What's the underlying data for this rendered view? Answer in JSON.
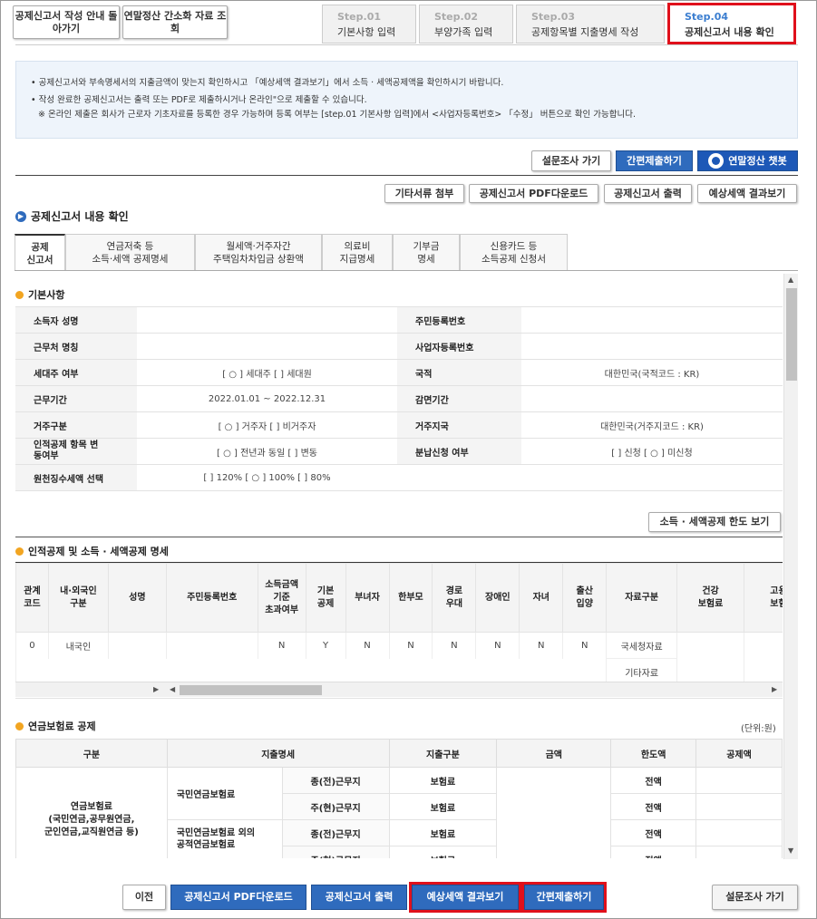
{
  "top_buttons": {
    "guide": "공제신고서 작성 안내 돌아가기",
    "lookup": "연말정산 간소화 자료 조회"
  },
  "steps": [
    {
      "num": "Step.01",
      "title": "기본사항 입력"
    },
    {
      "num": "Step.02",
      "title": "부양가족 입력"
    },
    {
      "num": "Step.03",
      "title": "공제항목별 지출명세 작성"
    },
    {
      "num": "Step.04",
      "title": "공제신고서 내용 확인"
    }
  ],
  "info": {
    "line1": "공제신고서와 부속명세서의 지출금액이 맞는지 확인하시고 「예상세액 결과보기」에서 소득 · 세액공제액을 확인하시기 바랍니다.",
    "line2": "작성 완료한 공제신고서는 출력 또는 PDF로 제출하시거나 온라인\"으로 제출할 수 있습니다.",
    "line3": "※ 온라인 제출은 회사가 근로자 기초자료를 등록한 경우 가능하며 등록 여부는 [step.01 기본사항 입력]에서 <사업자등록번호> 「수정」 버튼으로 확인 가능합니다."
  },
  "action_row1": {
    "survey": "설문조사 가기",
    "submit": "간편제출하기",
    "chatbot": "연말정산 챗봇"
  },
  "action_row2": {
    "attach": "기타서류 첨부",
    "pdf": "공제신고서 PDF다운로드",
    "print": "공제신고서 출력",
    "estimate": "예상세액 결과보기"
  },
  "page_title": "공제신고서 내용 확인",
  "tabs": [
    {
      "l1": "공제",
      "l2": "신고서"
    },
    {
      "l1": "연금저축 등",
      "l2": "소득·세액 공제명세"
    },
    {
      "l1": "월세액·거주자간",
      "l2": "주택임차차입금 상환액"
    },
    {
      "l1": "의료비",
      "l2": "지급명세"
    },
    {
      "l1": "기부금",
      "l2": "명세"
    },
    {
      "l1": "신용카드 등",
      "l2": "소득공제 신청서"
    }
  ],
  "basic": {
    "title": "기본사항",
    "rows": [
      {
        "h1": "소득자 성명",
        "v1": "",
        "h2": "주민등록번호",
        "v2": ""
      },
      {
        "h1": "근무처 명칭",
        "v1": "",
        "h2": "사업자등록번호",
        "v2": ""
      },
      {
        "h1": "세대주 여부",
        "v1": "[ ○ ] 세대주  [    ] 세대원",
        "h2": "국적",
        "v2": "대한민국(국적코드 : KR)"
      },
      {
        "h1": "근무기간",
        "v1": "2022.01.01 ~ 2022.12.31",
        "h2": "감면기간",
        "v2": ""
      },
      {
        "h1": "거주구분",
        "v1": "[ ○ ] 거주자  [    ] 비거주자",
        "h2": "거주지국",
        "v2": "대한민국(거주지코드 : KR)"
      },
      {
        "h1": "인적공제 항목 변동여부",
        "v1": "[ ○ ] 전년과 동일  [    ] 변동",
        "h2": "분납신청 여부",
        "v2": "[    ] 신청  [ ○ ] 미신청"
      },
      {
        "h1": "원천징수세액 선택",
        "v1": "[    ] 120%  [ ○ ] 100% [    ] 80%",
        "h2": "",
        "v2": ""
      }
    ]
  },
  "limit_button": "소득 · 세액공제 한도 보기",
  "deduction": {
    "title": "인적공제 및 소득 · 세액공제 명세",
    "headers": [
      "관계\n코드",
      "내·외국인\n구분",
      "성명",
      "주민등록번호",
      "소득금액\n기준\n초과여부",
      "기본\n공제",
      "부녀자",
      "한부모",
      "경로\n우대",
      "장애인",
      "자녀",
      "출산\n입양",
      "자료구분",
      "건강\n보험료",
      "고용\n보험"
    ],
    "row": [
      "0",
      "내국인",
      "",
      "",
      "N",
      "Y",
      "N",
      "N",
      "N",
      "N",
      "N",
      "N",
      "국세청자료",
      "",
      ""
    ],
    "row2_source": "기타자료"
  },
  "pension": {
    "title": "연금보험료 공제",
    "unit": "(단위:원)",
    "headers": [
      "구분",
      "지출명세",
      "지출구분",
      "금액",
      "한도액",
      "공제액"
    ],
    "group_label": "연금보험료\n(국민연금,공무원연금,\n군인연금,교직원연금 등)",
    "sub1": "국민연금보험료",
    "sub2": "국민연금보험료 외의\n공적연금보험료",
    "rows": [
      {
        "who": "종(전)근무지",
        "kind": "보험료",
        "limit": "전액"
      },
      {
        "who": "주(현)근무지",
        "kind": "보험료",
        "limit": "전액"
      },
      {
        "who": "종(전)근무지",
        "kind": "보험료",
        "limit": "전액"
      },
      {
        "who": "주(현)근무지",
        "kind": "보험료",
        "limit": "전액"
      }
    ]
  },
  "bottom": {
    "prev": "이전",
    "pdf": "공제신고서 PDF다운로드",
    "print": "공제신고서 출력",
    "estimate": "예상세액 결과보기",
    "submit": "간편제출하기",
    "survey": "설문조사 가기"
  },
  "colors": {
    "accent": "#2f6bbd",
    "highlight": "#e0101b",
    "bullet": "#f2a521"
  }
}
